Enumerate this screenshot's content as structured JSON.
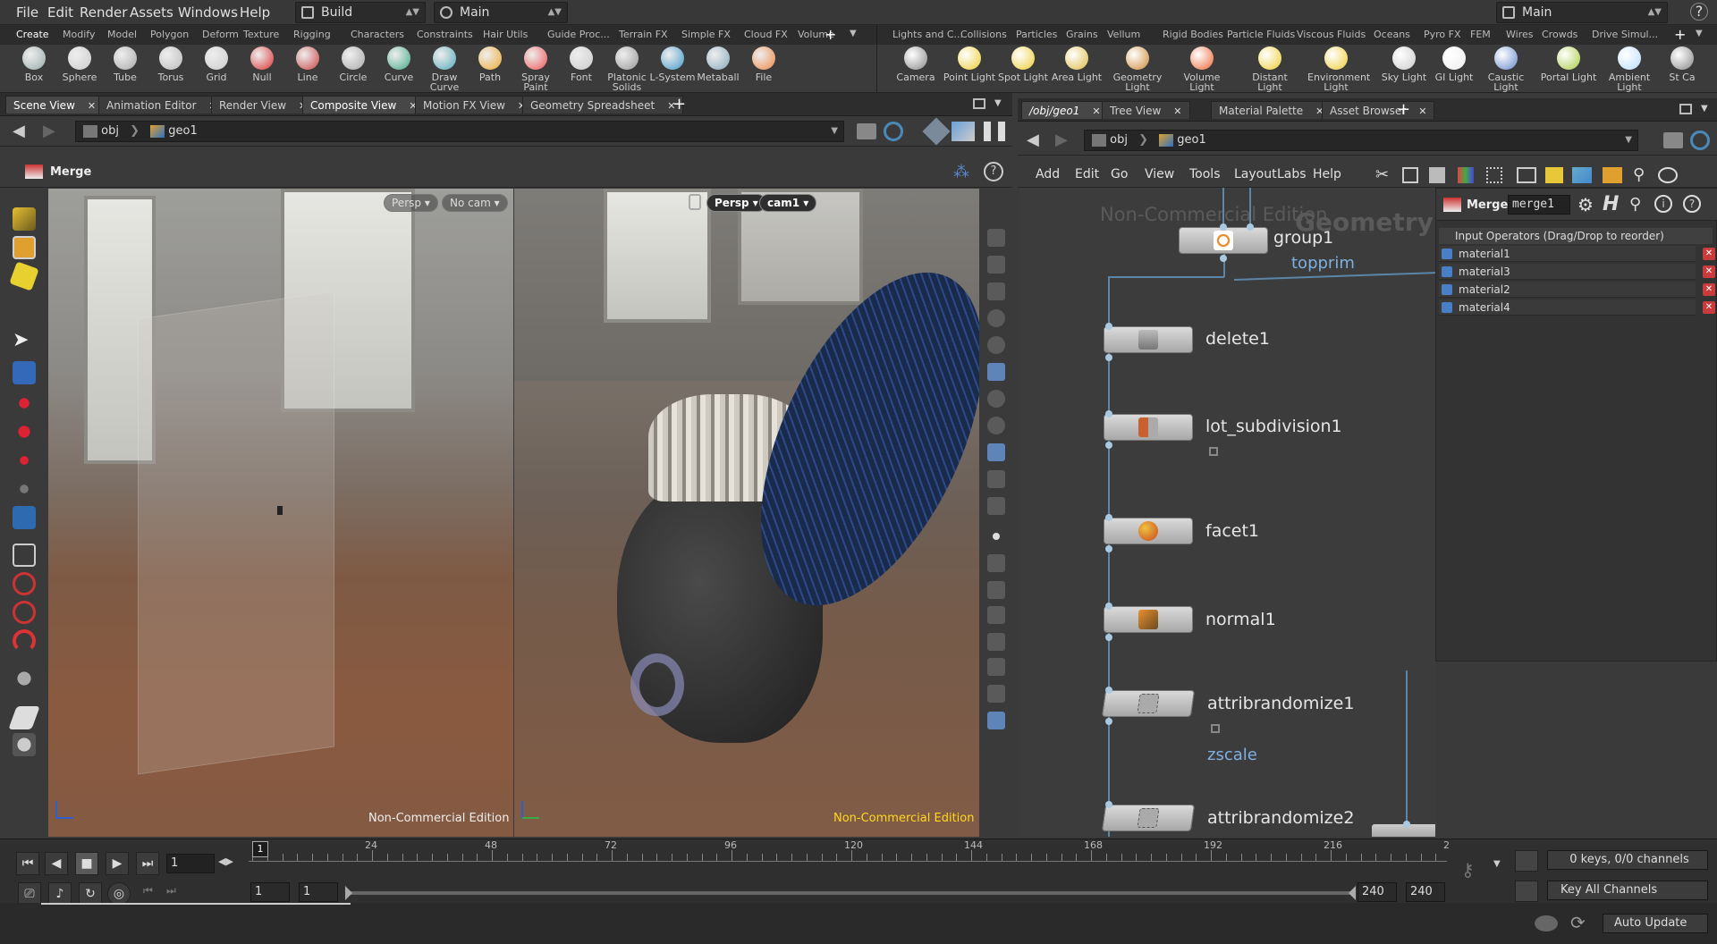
{
  "menubar": {
    "items": [
      "File",
      "Edit",
      "Render",
      "Assets",
      "Windows",
      "Help"
    ],
    "desktop_left": "Build",
    "desktop_mid": "Main",
    "desktop_right": "Main"
  },
  "shelf_tabs_left": [
    "Create",
    "Modify",
    "Model",
    "Polygon",
    "Deform",
    "Texture",
    "Rigging",
    "Characters",
    "Constraints",
    "Hair Utils",
    "Guide Proc...",
    "Terrain FX",
    "Simple FX",
    "Cloud FX",
    "Volume"
  ],
  "shelf_tabs_right": [
    "Lights and C...",
    "Collisions",
    "Particles",
    "Grains",
    "Vellum",
    "Rigid Bodies",
    "Particle Fluids",
    "Viscous Fluids",
    "Oceans",
    "Pyro FX",
    "FEM",
    "Wires",
    "Crowds",
    "Drive Simul..."
  ],
  "tools_left": [
    "Box",
    "Sphere",
    "Tube",
    "Torus",
    "Grid",
    "Null",
    "Line",
    "Circle",
    "Curve",
    "Draw Curve",
    "Path",
    "Spray Paint",
    "Font",
    "Platonic Solids",
    "L-System",
    "Metaball",
    "File"
  ],
  "tools_right": [
    "Camera",
    "Point Light",
    "Spot Light",
    "Area Light",
    "Geometry Light",
    "Volume Light",
    "Distant Light",
    "Environment Light",
    "Sky Light",
    "GI Light",
    "Caustic Light",
    "Portal Light",
    "Ambient Light",
    "St Ca"
  ],
  "left_pane_tabs": [
    "Scene View",
    "Animation Editor",
    "Render View",
    "Composite View",
    "Motion FX View",
    "Geometry Spreadsheet"
  ],
  "right_pane_tabs": [
    "/obj/geo1",
    "Tree View",
    "Material Palette",
    "Asset Browser"
  ],
  "path": {
    "root": "obj",
    "node": "geo1"
  },
  "viewer": {
    "title": "Merge",
    "left_view": "Persp",
    "left_cam": "No cam",
    "right_view": "Persp",
    "right_cam": "cam1",
    "watermark": "Non-Commercial Edition"
  },
  "network_menu": [
    "Add",
    "Edit",
    "Go",
    "View",
    "Tools",
    "Layout",
    "Labs",
    "Help"
  ],
  "network": {
    "watermark": "Non-Commercial Edition",
    "context": "Geometry",
    "nodes": [
      "group1",
      "delete1",
      "lot_subdivision1",
      "facet1",
      "normal1",
      "attribrandomize1",
      "attribrandomize2"
    ],
    "group_out": "topprim",
    "rand_flag": "zscale"
  },
  "params": {
    "type": "Merge",
    "name": "merge1",
    "list_header": "Input Operators (Drag/Drop to reorder)",
    "inputs": [
      "material1",
      "material3",
      "material2",
      "material4"
    ]
  },
  "timeline": {
    "frame": "1",
    "ticks": [
      "1",
      "24",
      "48",
      "72",
      "96",
      "120",
      "144",
      "168",
      "192",
      "216",
      "2"
    ],
    "start": "1",
    "start2": "1",
    "end": "240",
    "end2": "240",
    "keys": "0 keys, 0/0 channels",
    "key_all": "Key All Channels",
    "auto": "Auto Update"
  }
}
